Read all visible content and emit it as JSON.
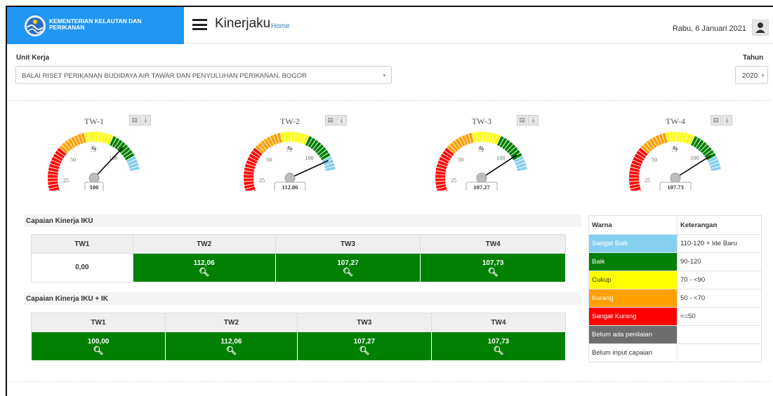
{
  "header": {
    "org_name": "KEMENTERIAN KELAUTAN DAN PERIKANAN",
    "app_title": "Kinerjaku",
    "home_link": "Home",
    "date": "Rabu, 6 Januari 2021"
  },
  "filters": {
    "unit_label": "Unit Kerja",
    "unit_value": "BALAI RISET PERIKANAN BUDIDAYA AIR TAWAR DAN PENYULUHAN PERIKANAN, BOGOR",
    "year_label": "Tahun",
    "year_value": "2020"
  },
  "gauges": [
    {
      "title": "TW-1",
      "value": 100,
      "display": "100"
    },
    {
      "title": "TW-2",
      "value": 112.06,
      "display": "112.06"
    },
    {
      "title": "TW-3",
      "value": 107.27,
      "display": "107.27"
    },
    {
      "title": "TW-4",
      "value": 107.73,
      "display": "107.73"
    }
  ],
  "gauge_labels": {
    "t0": "0",
    "t25": "25",
    "t50": "50",
    "t75": "75",
    "t100": "100",
    "unit": "%"
  },
  "colors": {
    "sangat_baik": "#87cfee",
    "baik": "#008000",
    "cukup": "#ffff00",
    "kurang": "#ff9f00",
    "sangat_kurang": "#ff0000",
    "belum_penilaian": "#6d6d6d"
  },
  "iku": {
    "title": "Capaian Kinerja IKU",
    "headers": [
      "TW1",
      "TW2",
      "TW3",
      "TW4"
    ],
    "values": [
      "0,00",
      "112,06",
      "107,27",
      "107,73"
    ]
  },
  "iku_ik": {
    "title": "Capaian Kinerja IKU + IK",
    "headers": [
      "TW1",
      "TW2",
      "TW3",
      "TW4"
    ],
    "values": [
      "100,00",
      "112,06",
      "107,27",
      "107,73"
    ]
  },
  "legend": {
    "col_warna": "Warna",
    "col_keterangan": "Keterangan",
    "rows": [
      {
        "warna": "Sangat Baik",
        "ket": "110-120 + Ide Baru"
      },
      {
        "warna": "Baik",
        "ket": "90-120"
      },
      {
        "warna": "Cukup",
        "ket": "70 - <90"
      },
      {
        "warna": "Kurang",
        "ket": "50 - <70"
      },
      {
        "warna": "Sangat Kurang",
        "ket": "<=50"
      },
      {
        "warna": "Belum ada penilaian",
        "ket": ""
      },
      {
        "warna": "Belum input capaian",
        "ket": ""
      }
    ]
  }
}
